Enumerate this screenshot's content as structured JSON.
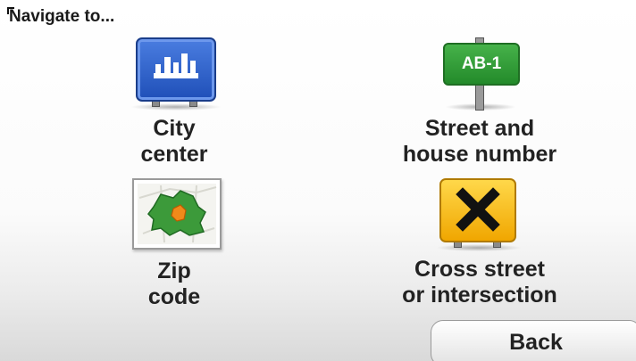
{
  "header": {
    "title": "Navigate to..."
  },
  "options": [
    {
      "label": "City\ncenter",
      "icon": "city-center-sign-icon",
      "color": "#2f63cc"
    },
    {
      "label": "Street and\nhouse number",
      "icon": "street-sign-icon",
      "sign_text": "AB-1",
      "color": "#2f9a35"
    },
    {
      "label": "Zip\ncode",
      "icon": "zip-map-icon",
      "color": "#3aa23f"
    },
    {
      "label": "Cross street\nor intersection",
      "icon": "cross-sign-icon",
      "color": "#f5b800"
    }
  ],
  "footer": {
    "back_label": "Back"
  }
}
